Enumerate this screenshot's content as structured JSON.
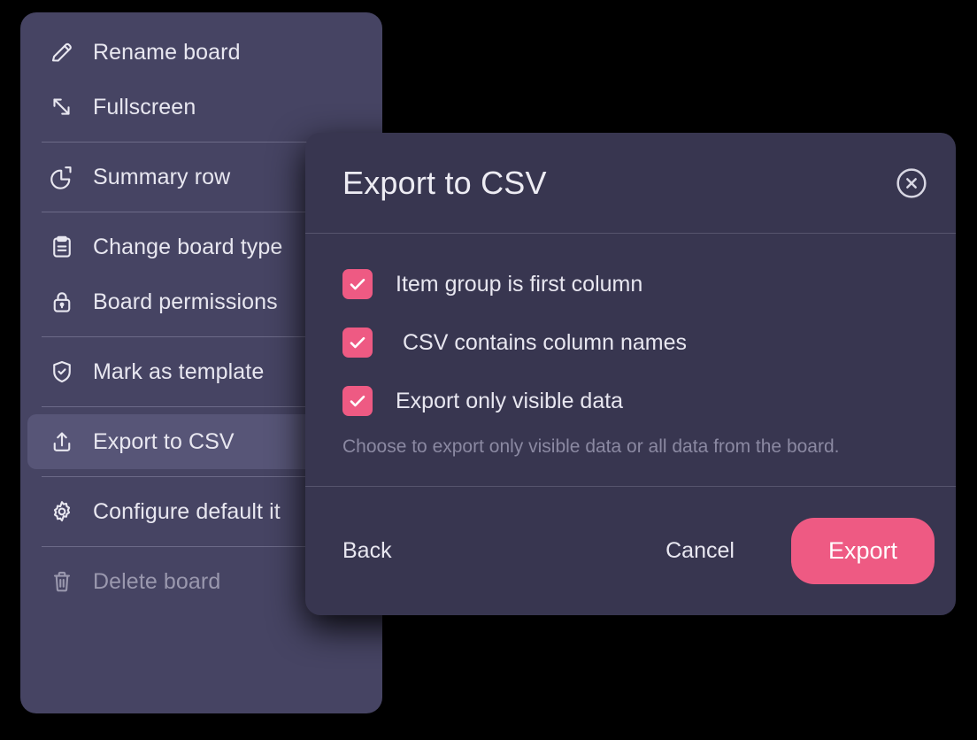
{
  "theme": {
    "page_background": "#000000",
    "menu_background": "#464463",
    "menu_selected_background": "#575577",
    "dialog_background": "#383650",
    "accent_pink": "#EE5A83",
    "text_primary": "#E8E7F0",
    "text_muted": "#8B89A2",
    "divider": "#56546D"
  },
  "context_menu": {
    "groups": [
      {
        "items": [
          {
            "label": "Rename board",
            "icon": "pencil-icon",
            "state": "normal"
          },
          {
            "label": "Fullscreen",
            "icon": "fullscreen-arrows-icon",
            "state": "normal"
          }
        ]
      },
      {
        "items": [
          {
            "label": "Summary row",
            "icon": "pie-chart-icon",
            "state": "normal"
          }
        ]
      },
      {
        "items": [
          {
            "label": "Change board type",
            "icon": "clipboard-icon",
            "state": "normal"
          },
          {
            "label": "Board permissions",
            "icon": "lock-icon",
            "state": "normal"
          }
        ]
      },
      {
        "items": [
          {
            "label": "Mark as template",
            "icon": "shield-check-icon",
            "state": "normal"
          }
        ]
      },
      {
        "items": [
          {
            "label": "Export to CSV",
            "icon": "upload-icon",
            "state": "selected"
          }
        ]
      },
      {
        "items": [
          {
            "label": "Configure default it",
            "icon": "gear-icon",
            "state": "normal"
          }
        ]
      },
      {
        "items": [
          {
            "label": "Delete board",
            "icon": "trash-icon",
            "state": "disabled"
          }
        ]
      }
    ]
  },
  "export_dialog": {
    "title": "Export to CSV",
    "close_icon": "close-circle-icon",
    "options": [
      {
        "label": "Item group is first column",
        "checked": true
      },
      {
        "label": "CSV contains column names",
        "checked": true
      },
      {
        "label": "Export only visible data",
        "checked": true
      }
    ],
    "helper_text": "Choose to export only visible data or all data from the board.",
    "footer": {
      "back_label": "Back",
      "cancel_label": "Cancel",
      "export_label": "Export"
    }
  }
}
